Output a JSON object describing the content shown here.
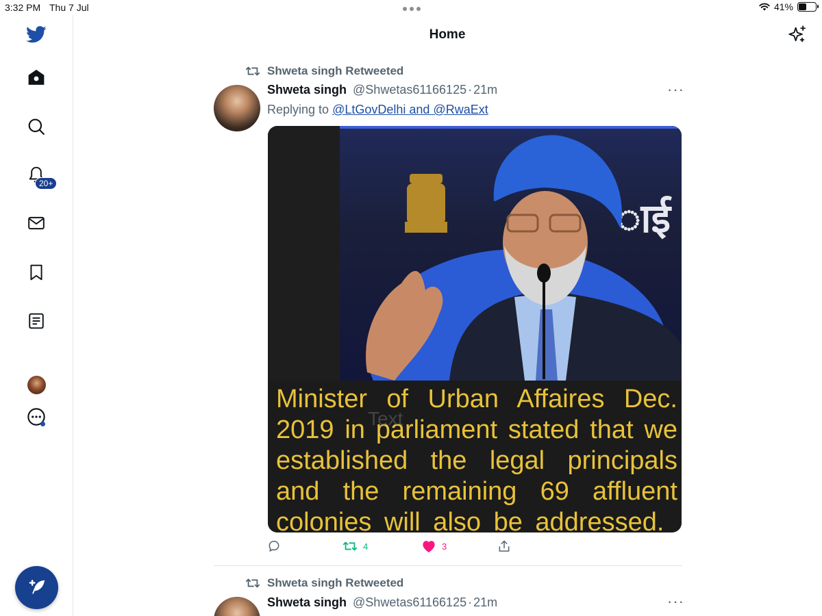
{
  "status_bar": {
    "time": "3:32 PM",
    "date": "Thu 7 Jul",
    "battery_text": "41%",
    "battery_level": 0.41
  },
  "sidebar": {
    "items": [
      {
        "icon": "twitter-bird-icon"
      },
      {
        "icon": "home-icon"
      },
      {
        "icon": "search-icon"
      },
      {
        "icon": "bell-icon",
        "badge": "20+"
      },
      {
        "icon": "mail-icon"
      },
      {
        "icon": "bookmark-icon"
      },
      {
        "icon": "lists-icon"
      },
      {
        "icon": "profile-avatar"
      },
      {
        "icon": "more-icon"
      }
    ],
    "compose_icon": "compose-feather-icon"
  },
  "header": {
    "title": "Home",
    "sparkle_icon": "sparkle-icon"
  },
  "tweets": [
    {
      "retweet_label": "Shweta singh Retweeted",
      "name": "Shweta singh",
      "handle": "@Shwetas61166125",
      "sep": "·",
      "time": "21m",
      "replying_prefix": "Replying to",
      "replying_to": "@LtGovDelhi and @RwaExt",
      "more": "···",
      "media_caption": [
        "Minister of Urban Affaires Dec.",
        "2019 in parliament stated that we",
        "established the legal principals",
        "and the remaining 69 affluent",
        "colonies will also be addressed."
      ],
      "media_watermark": "Text",
      "actions": {
        "reply_count": "",
        "retweet_count": "4",
        "like_count": "3"
      }
    },
    {
      "retweet_label": "Shweta singh Retweeted",
      "name": "Shweta singh",
      "handle": "@Shwetas61166125",
      "sep": "·",
      "time": "21m",
      "more": "···"
    }
  ],
  "colors": {
    "brand_blue": "#1d9bf0",
    "compose_bg": "#17408f",
    "like_pink": "#f91880",
    "retweet_green": "#00ba7c",
    "caption_yellow": "#e8c23a"
  }
}
